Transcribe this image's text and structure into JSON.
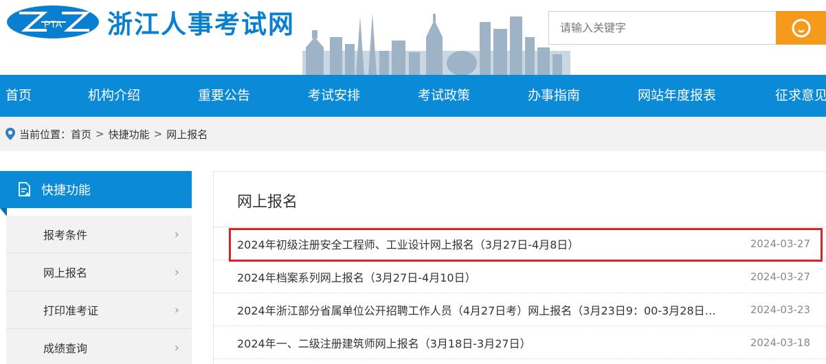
{
  "header": {
    "logo_text": "PTA",
    "site_title": "浙江人事考试网",
    "search": {
      "placeholder": "请输入关键字"
    },
    "colors": {
      "brand_blue": "#0b7fcf",
      "search_orange": "#f59a1a"
    }
  },
  "nav": {
    "items": [
      {
        "label": "首页"
      },
      {
        "label": "机构介绍"
      },
      {
        "label": "重要公告"
      },
      {
        "label": "考试安排"
      },
      {
        "label": "考试政策"
      },
      {
        "label": "办事指南"
      },
      {
        "label": "网站年度报表"
      },
      {
        "label": "征求意见"
      }
    ]
  },
  "breadcrumb": {
    "prefix": "当前位置：",
    "items": [
      "首页",
      "快捷功能",
      "网上报名"
    ],
    "separator": ">"
  },
  "sidebar": {
    "title": "快捷功能",
    "items": [
      {
        "label": "报考条件"
      },
      {
        "label": "网上报名"
      },
      {
        "label": "打印准考证"
      },
      {
        "label": "成绩查询"
      }
    ]
  },
  "main": {
    "title": "网上报名",
    "rows": [
      {
        "title": "2024年初级注册安全工程师、工业设计网上报名（3月27日-4月8日）",
        "date": "2024-03-27"
      },
      {
        "title": "2024年档案系列网上报名（3月27日-4月10日）",
        "date": "2024-03-27"
      },
      {
        "title": "2024年浙江部分省属单位公开招聘工作人员（4月27日考）网上报名（3月23日9：00-3月28日1...",
        "date": "2024-03-23"
      },
      {
        "title": "2024年一、二级注册建筑师网上报名（3月18日-3月27日）",
        "date": "2024-03-18"
      }
    ]
  }
}
